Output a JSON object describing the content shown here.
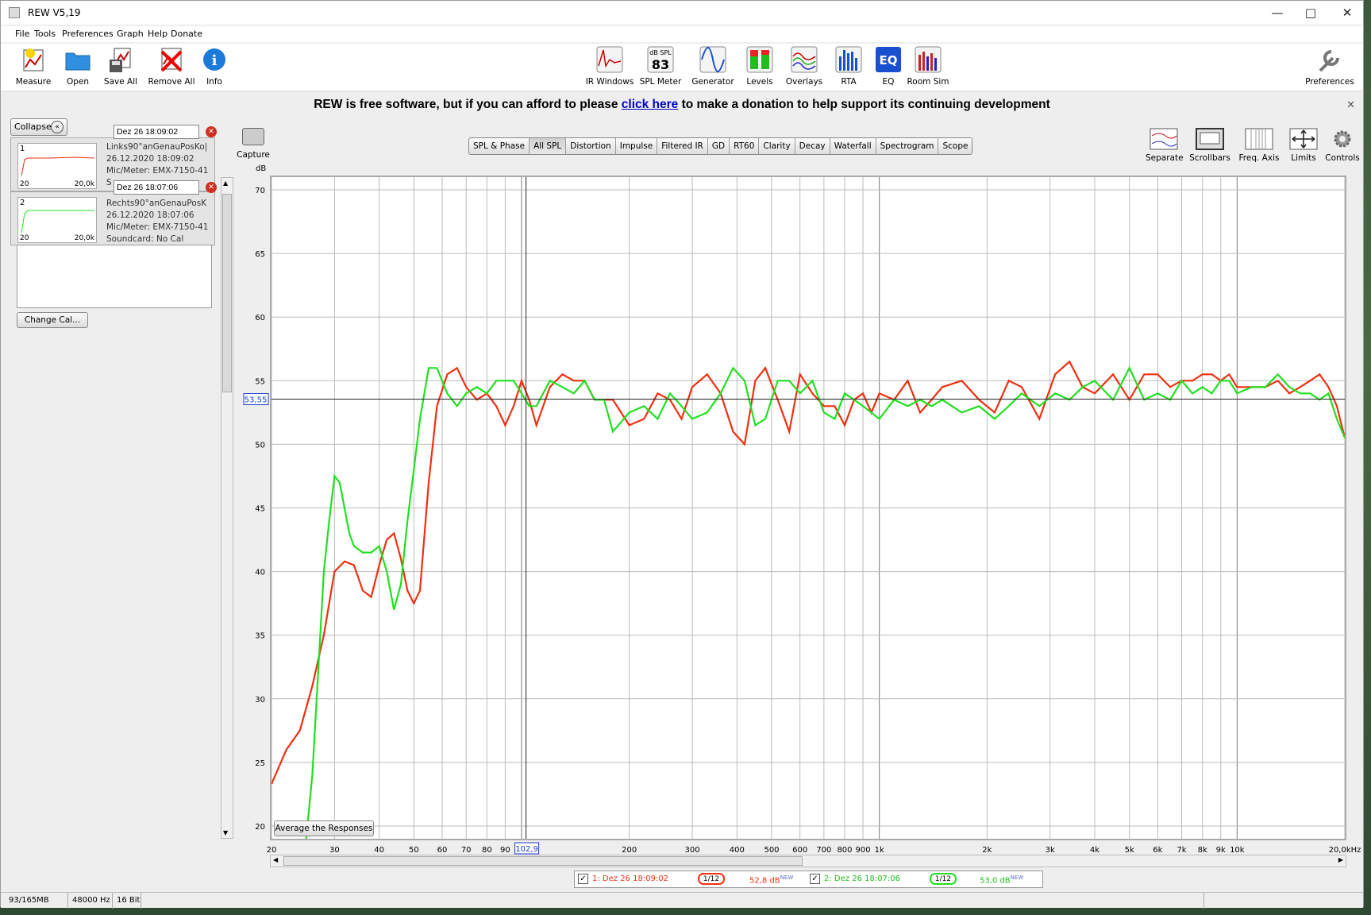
{
  "window": {
    "title": "REW V5,19"
  },
  "menu": [
    "File",
    "Tools",
    "Preferences",
    "Graph",
    "Help",
    "Donate"
  ],
  "toolbar_left": [
    "Measure",
    "Open",
    "Save All",
    "Remove All",
    "Info"
  ],
  "toolbar_center": [
    "IR Windows",
    "SPL Meter",
    "Generator",
    "Levels",
    "Overlays",
    "RTA",
    "EQ",
    "Room Sim"
  ],
  "toolbar_right": [
    "Preferences"
  ],
  "spl_meter_icon": {
    "top": "dB SPL",
    "value": "83"
  },
  "donate": {
    "pre": "REW is free software, but if you can afford to please",
    "link": "click here",
    "post": "to make a donation to help support its continuing development"
  },
  "panel": {
    "collapse": "Collapse",
    "change_cal": "Change Cal...",
    "measurements": [
      {
        "num": "1",
        "date_field": "Dez 26 18:09:02",
        "name": "Links90°anGenauPosKo|",
        "timestamp": "26.12.2020 18:09:02",
        "mic": "Mic/Meter: EMX-7150-41",
        "soundcard": "S",
        "thumb_left": "20",
        "thumb_right": "20,0k",
        "color": "#f03010"
      },
      {
        "num": "2",
        "date_field": "Dez 26 18:07:06",
        "name": "Rechts90°anGenauPosK",
        "timestamp": "26.12.2020 18:07:06",
        "mic": "Mic/Meter: EMX-7150-41",
        "soundcard": "Soundcard: No Cal",
        "thumb_left": "20",
        "thumb_right": "20,0k",
        "color": "#20e020"
      }
    ]
  },
  "graph": {
    "capture": "Capture",
    "tabs": [
      "SPL & Phase",
      "All SPL",
      "Distortion",
      "Impulse",
      "Filtered IR",
      "GD",
      "RT60",
      "Clarity",
      "Decay",
      "Waterfall",
      "Spectrogram",
      "Scope"
    ],
    "active_tab": "All SPL",
    "tools": [
      "Separate",
      "Scrollbars",
      "Freq. Axis",
      "Limits",
      "Controls"
    ],
    "average_button": "Average the Responses",
    "y_unit": "dB",
    "cursor_freq": "102,9",
    "cursor_level": "53,55"
  },
  "chart_data": {
    "type": "line",
    "title": "",
    "xlabel": "",
    "ylabel": "dB",
    "xscale": "log",
    "xlim": [
      20,
      20000
    ],
    "ylim": [
      19,
      71
    ],
    "xticks": [
      20,
      30,
      40,
      50,
      60,
      70,
      80,
      90,
      200,
      300,
      400,
      500,
      600,
      700,
      800,
      900,
      1000,
      2000,
      3000,
      4000,
      5000,
      6000,
      7000,
      8000,
      9000,
      10000,
      20000
    ],
    "xtick_labels": [
      "20",
      "30",
      "40",
      "50",
      "60",
      "70",
      "80",
      "90",
      "200",
      "300",
      "400",
      "500",
      "600",
      "700",
      "800",
      "900",
      "1k",
      "2k",
      "3k",
      "4k",
      "5k",
      "6k",
      "7k",
      "8k",
      "9k",
      "10k",
      "20,0kHz"
    ],
    "yticks": [
      20,
      25,
      30,
      35,
      40,
      45,
      50,
      55,
      60,
      65,
      70
    ],
    "cursor": {
      "x": 102.9,
      "y": 53.55
    },
    "grid": true,
    "series": [
      {
        "name": "1: Dez 26 18:09:02",
        "color": "#f03010",
        "smoothing": "1/12",
        "level": "52,8 dB",
        "badge": "NEW",
        "x": [
          20,
          22,
          24,
          26,
          28,
          30,
          32,
          34,
          36,
          38,
          40,
          42,
          44,
          46,
          48,
          50,
          52,
          55,
          58,
          62,
          66,
          70,
          75,
          80,
          85,
          90,
          95,
          100,
          105,
          110,
          120,
          130,
          140,
          150,
          160,
          170,
          180,
          200,
          220,
          240,
          260,
          280,
          300,
          330,
          360,
          390,
          420,
          450,
          480,
          520,
          560,
          600,
          650,
          700,
          750,
          800,
          850,
          900,
          950,
          1000,
          1100,
          1200,
          1300,
          1400,
          1500,
          1700,
          1900,
          2100,
          2300,
          2500,
          2800,
          3100,
          3400,
          3700,
          4000,
          4500,
          5000,
          5500,
          6000,
          6500,
          7000,
          7500,
          8000,
          8500,
          9000,
          9500,
          10000,
          11000,
          12000,
          13000,
          14000,
          15000,
          16000,
          17000,
          18000,
          19000,
          20000
        ],
        "y": [
          23.3,
          26.0,
          27.5,
          31.0,
          35.0,
          40.0,
          40.8,
          40.5,
          38.5,
          38.0,
          40.5,
          42.5,
          43.0,
          41.0,
          38.5,
          37.5,
          38.5,
          47.0,
          53.0,
          55.5,
          56.0,
          54.5,
          53.5,
          54.0,
          53.0,
          51.5,
          53.0,
          55.0,
          53.5,
          51.5,
          54.5,
          55.5,
          55.0,
          55.0,
          53.5,
          53.5,
          53.5,
          51.5,
          52.0,
          54.0,
          53.5,
          52.0,
          54.5,
          55.5,
          54.0,
          51.0,
          50.0,
          55.0,
          56.0,
          53.5,
          51.0,
          55.5,
          54.0,
          53.0,
          53.0,
          51.5,
          53.5,
          54.0,
          52.5,
          54.0,
          53.5,
          55.0,
          52.5,
          53.5,
          54.5,
          55.0,
          53.5,
          52.5,
          55.0,
          54.5,
          52.0,
          55.5,
          56.5,
          54.5,
          54.0,
          55.5,
          53.5,
          55.5,
          55.5,
          54.5,
          55.0,
          55.0,
          55.5,
          55.5,
          55.0,
          55.5,
          54.5,
          54.5,
          54.5,
          55.0,
          54.0,
          54.5,
          55.0,
          55.5,
          54.5,
          53.0,
          50.5
        ]
      },
      {
        "name": "2: Dez 26 18:07:06",
        "color": "#20e020",
        "smoothing": "1/12",
        "level": "53,0 dB",
        "badge": "NEW",
        "x": [
          25,
          26,
          27,
          28,
          29,
          30,
          31,
          32,
          33,
          34,
          36,
          38,
          40,
          42,
          44,
          46,
          48,
          50,
          52,
          55,
          58,
          62,
          66,
          70,
          75,
          80,
          85,
          90,
          95,
          100,
          105,
          110,
          120,
          130,
          140,
          150,
          160,
          170,
          180,
          200,
          220,
          240,
          260,
          280,
          300,
          330,
          360,
          390,
          420,
          450,
          480,
          520,
          560,
          600,
          650,
          700,
          750,
          800,
          850,
          900,
          950,
          1000,
          1100,
          1200,
          1300,
          1400,
          1500,
          1700,
          1900,
          2100,
          2300,
          2500,
          2800,
          3100,
          3400,
          3700,
          4000,
          4500,
          5000,
          5500,
          6000,
          6500,
          7000,
          7500,
          8000,
          8500,
          9000,
          9500,
          10000,
          11000,
          12000,
          13000,
          14000,
          15000,
          16000,
          17000,
          18000,
          19000,
          20000
        ],
        "y": [
          19.0,
          24.0,
          32.0,
          40.0,
          44.0,
          47.5,
          47.0,
          45.0,
          43.0,
          42.0,
          41.5,
          41.5,
          42.0,
          40.0,
          37.0,
          39.0,
          44.0,
          48.0,
          52.0,
          56.0,
          56.0,
          54.0,
          53.0,
          54.0,
          54.5,
          54.0,
          55.0,
          55.0,
          55.0,
          54.0,
          53.0,
          53.0,
          55.0,
          54.5,
          54.0,
          55.0,
          53.5,
          53.5,
          51.0,
          52.5,
          53.0,
          52.0,
          54.0,
          53.0,
          52.0,
          52.5,
          54.0,
          56.0,
          55.0,
          51.5,
          52.0,
          55.0,
          55.0,
          54.0,
          55.0,
          52.5,
          52.0,
          54.0,
          53.5,
          53.0,
          52.5,
          52.0,
          53.5,
          53.0,
          53.5,
          53.0,
          53.5,
          52.5,
          53.0,
          52.0,
          53.0,
          54.0,
          53.0,
          54.0,
          53.5,
          54.5,
          55.0,
          53.5,
          56.0,
          53.5,
          54.0,
          53.5,
          55.0,
          54.0,
          54.5,
          54.0,
          55.0,
          55.0,
          54.0,
          54.5,
          54.5,
          55.5,
          54.5,
          54.0,
          54.0,
          53.5,
          54.0,
          52.0,
          50.5
        ]
      }
    ]
  },
  "status": {
    "memory": "93/165MB",
    "rate": "48000 Hz",
    "bits": "16 Bit"
  }
}
